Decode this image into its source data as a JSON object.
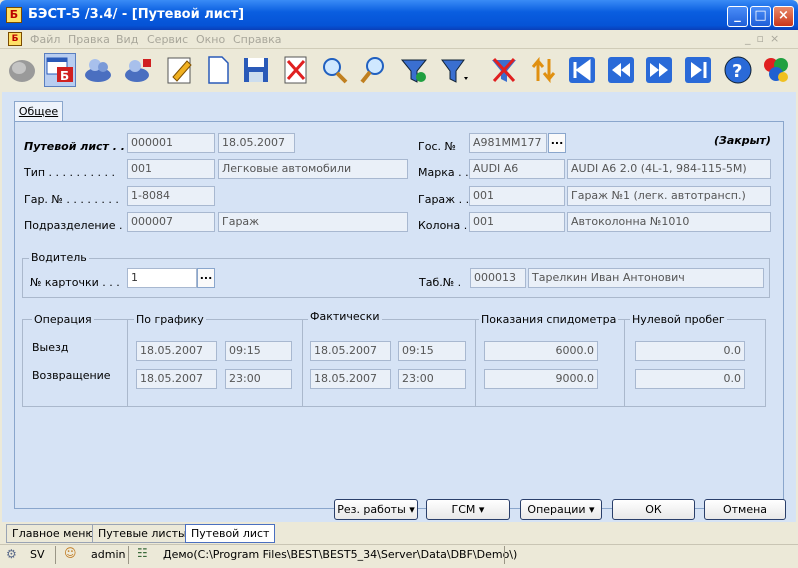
{
  "window": {
    "title": "БЭСТ-5 /3.4/ - [Путевой лист]",
    "icon_letter": "Б"
  },
  "menu": [
    "Файл",
    "Правка",
    "Вид",
    "Сервис",
    "Окно",
    "Справка"
  ],
  "toolbar_icons": [
    "cloud-icon",
    "window-icon",
    "users-icon",
    "user-link-icon",
    "edit-icon",
    "new-document-icon",
    "save-icon",
    "delete-icon",
    "search-icon",
    "find-icon",
    "filter-icon",
    "filter-dropdown-icon",
    "clear-filter-icon",
    "sort-icon",
    "first-record-icon",
    "previous-record-icon",
    "next-record-icon",
    "last-record-icon",
    "help-icon",
    "modules-icon"
  ],
  "tab": "Общее",
  "waybill": {
    "label": "Путевой лист . .",
    "number": "000001",
    "date": "18.05.2007",
    "status": "(Закрыт)"
  },
  "type": {
    "label": "Тип . . . . . . . . . .",
    "code": "001",
    "name": "Легковые автомобили"
  },
  "garage_number": {
    "label": "Гар. № . . . . . . . .",
    "value": "1-8084"
  },
  "department": {
    "label": "Подразделение . .",
    "code": "000007",
    "name": "Гараж"
  },
  "plate": {
    "label": "Гос. №",
    "value": "А981ММ177",
    "button": "..."
  },
  "brand": {
    "label": "Марка . .",
    "code": "AUDI A6",
    "name": "AUDI A6 2.0 (4L-1, 984-115-5M)"
  },
  "garage": {
    "label": "Гараж . .",
    "code": "001",
    "name": "Гараж №1 (легк. автотрансп.)"
  },
  "column": {
    "label": "Колона . .",
    "code": "001",
    "name": "Автоколонна №1010"
  },
  "driver": {
    "group_label": "Водитель",
    "card_label": "№ карточки . . .",
    "card": "1",
    "button": "...",
    "tab_label": "Таб.№ .",
    "tab_no": "000013",
    "name": "Тарелкин Иван Антонович"
  },
  "ops": {
    "operation_label": "Операция",
    "schedule_label": "По графику",
    "actual_label": "Фактически",
    "odometer_label": "Показания спидометра",
    "zero_label": "Нулевой пробег",
    "rows": [
      {
        "name": "Выезд",
        "plan_date": "18.05.2007",
        "plan_time": "09:15",
        "fact_date": "18.05.2007",
        "fact_time": "09:15",
        "odometer": "6000.0",
        "zero": "0.0"
      },
      {
        "name": "Возвращение",
        "plan_date": "18.05.2007",
        "plan_time": "23:00",
        "fact_date": "18.05.2007",
        "fact_time": "23:00",
        "odometer": "9000.0",
        "zero": "0.0"
      }
    ]
  },
  "buttons": {
    "results": "Рез. работы",
    "fuel": "ГСМ",
    "operations": "Операции",
    "ok": "ОК",
    "cancel": "Отмена"
  },
  "tabs_bottom": [
    "Главное меню",
    "Путевые листы",
    "Путевой лист"
  ],
  "status": {
    "server": "SV",
    "user": "admin",
    "path": "Демо(C:\\Program Files\\BEST\\BEST5_34\\Server\\Data\\DBF\\Demo\\)"
  }
}
